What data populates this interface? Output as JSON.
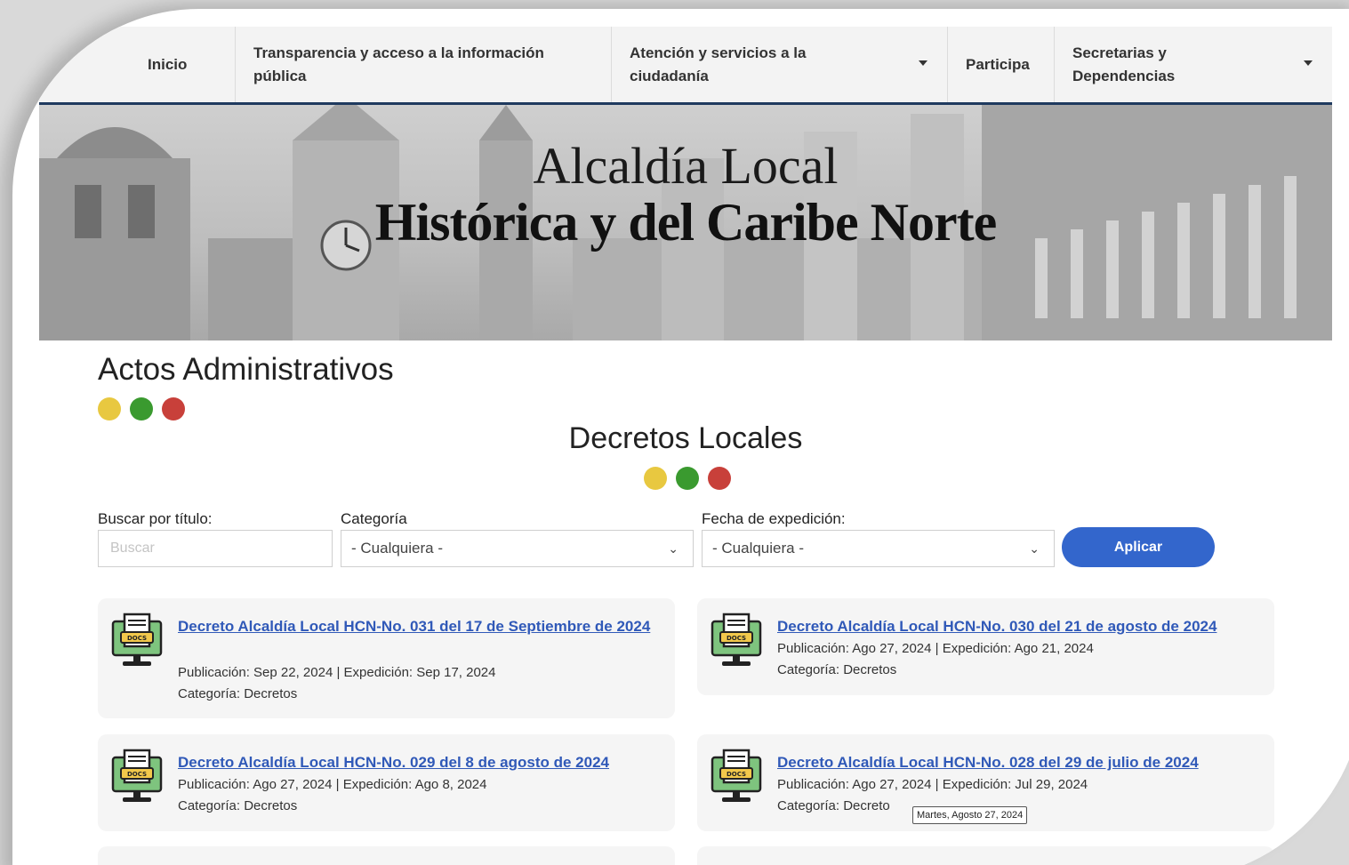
{
  "nav": {
    "items": [
      {
        "label": "Inicio"
      },
      {
        "label": "Transparencia y acceso a la información pública"
      },
      {
        "label": "Atención y servicios a la ciudadanía"
      },
      {
        "label": "Participa"
      },
      {
        "label": "Secretarias y Dependencias"
      }
    ]
  },
  "hero": {
    "line1": "Alcaldía Local",
    "line2": "Histórica y del Caribe Norte"
  },
  "section": {
    "title": "Actos Administrativos",
    "subtitle": "Decretos Locales"
  },
  "filters": {
    "search_label": "Buscar por título:",
    "search_placeholder": "Buscar",
    "category_label": "Categoría",
    "category_value": "- Cualquiera -",
    "date_label": "Fecha de expedición:",
    "date_value": "- Cualquiera -",
    "apply_label": "Aplicar"
  },
  "colors": {
    "yellow": "#e8c840",
    "green": "#3a9a2f",
    "red": "#c8403a",
    "accent": "#3366cc",
    "nav_border": "#1f3a5f"
  },
  "decrees": [
    {
      "title": "Decreto Alcaldía Local HCN-No. 031 del 17 de Septiembre de 2024",
      "dates": "Publicación: Sep 22, 2024 | Expedición: Sep 17, 2024",
      "category": "Categoría: Decretos",
      "icon": "docs-monitor-icon"
    },
    {
      "title": "Decreto Alcaldía Local HCN-No. 030 del 21 de agosto de 2024",
      "dates": "Publicación: Ago 27, 2024 | Expedición: Ago 21, 2024",
      "category": "Categoría: Decretos",
      "icon": "docs-monitor-icon"
    },
    {
      "title": "Decreto Alcaldía Local HCN-No. 029 del 8 de agosto de 2024",
      "dates": "Publicación: Ago 27, 2024 | Expedición: Ago 8, 2024",
      "category": "Categoría: Decretos",
      "icon": "docs-monitor-icon"
    },
    {
      "title": "Decreto Alcaldía Local HCN-No. 028 del 29 de julio de 2024",
      "dates": "Publicación: Ago 27, 2024 | Expedición: Jul 29, 2024",
      "category": "Categoría: Decreto",
      "icon": "docs-monitor-icon"
    }
  ],
  "tooltip": {
    "text": "Martes, Agosto 27, 2024"
  }
}
